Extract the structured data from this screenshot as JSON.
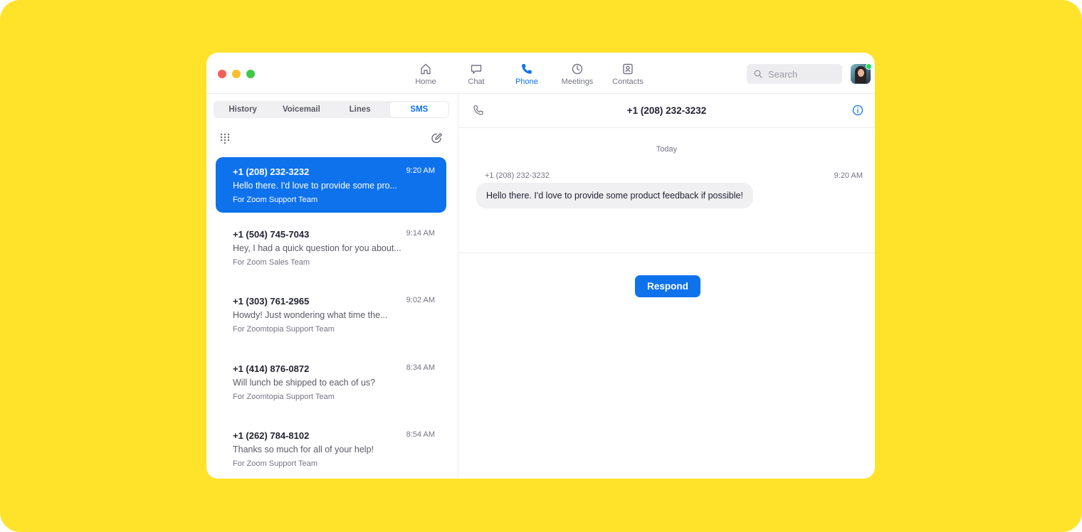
{
  "nav": {
    "tabs": [
      {
        "label": "Home",
        "icon": "home-icon"
      },
      {
        "label": "Chat",
        "icon": "chat-icon"
      },
      {
        "label": "Phone",
        "icon": "phone-icon",
        "active": true
      },
      {
        "label": "Meetings",
        "icon": "clock-icon"
      },
      {
        "label": "Contacts",
        "icon": "contacts-icon"
      }
    ],
    "search_placeholder": "Search"
  },
  "sms": {
    "segments": [
      "History",
      "Voicemail",
      "Lines",
      "SMS"
    ],
    "active_segment": "SMS",
    "messages": [
      {
        "number": "+1 (208) 232-3232",
        "time": "9:20 AM",
        "preview": "Hello there. I'd love to provide some pro...",
        "team": "For Zoom Support Team",
        "active": true
      },
      {
        "number": "+1 (504) 745-7043",
        "time": "9:14 AM",
        "preview": "Hey, I had a quick question for you about...",
        "team": "For Zoom Sales Team"
      },
      {
        "number": "+1 (303) 761-2965",
        "time": "9:02 AM",
        "preview": "Howdy! Just wondering what time the...",
        "team": "For Zoomtopia Support Team"
      },
      {
        "number": "+1 (414) 876-0872",
        "time": "8:34 AM",
        "preview": "Will lunch be shipped to each of us?",
        "team": "For Zoomtopia Support Team"
      },
      {
        "number": "+1 (262) 784-8102",
        "time": "8:54 AM",
        "preview": "Thanks so much for all of your help!",
        "team": "For Zoom Support Team"
      }
    ]
  },
  "conversation": {
    "title": "+1 (208) 232-3232",
    "day_label": "Today",
    "sender": "+1 (208) 232-3232",
    "time": "9:20 AM",
    "message": "Hello there. I'd love to provide some product feedback if possible!",
    "respond_label": "Respond"
  },
  "colors": {
    "background": "#FFE22A",
    "accent": "#0e72ed",
    "presence": "#23d959"
  }
}
